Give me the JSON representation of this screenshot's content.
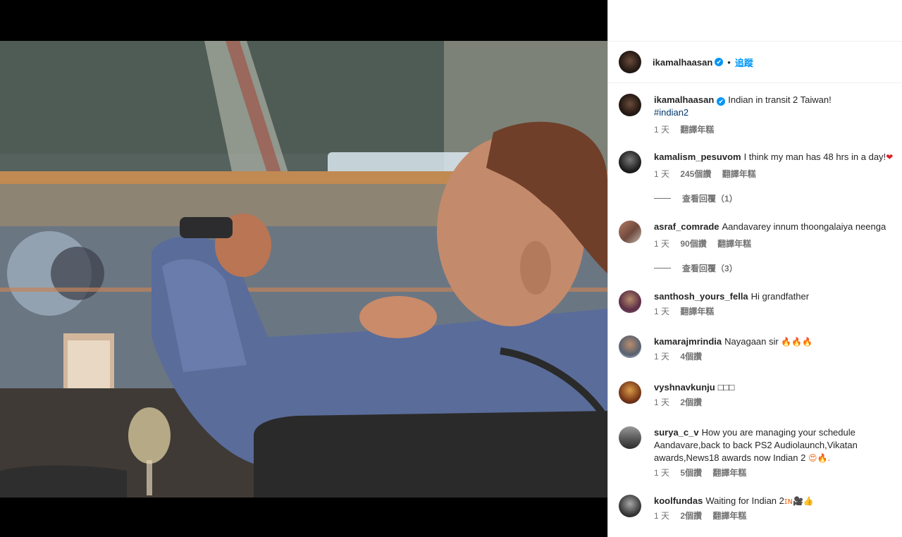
{
  "post": {
    "owner": "ikamalhaasan",
    "follow_label": "追蹤",
    "separator": "•",
    "verified_mark": "✔"
  },
  "caption": {
    "user": "ikamalhaasan",
    "text": "Indian in transit 2 Taiwan!",
    "hashtag": "#indian2",
    "time": "1 天",
    "translate": "翻譯年糕"
  },
  "comments": [
    {
      "user": "kamalism_pesuvom",
      "text": "I think my man has 48 hrs in a day!",
      "emoji": "❤",
      "time": "1 天",
      "likes": "245個讚",
      "translate": "翻譯年糕",
      "replies": "查看回覆（1）",
      "heart_icon": "heart-icon"
    },
    {
      "user": "asraf_comrade",
      "text": "Aandavarey innum thoongalaiya neenga",
      "time": "1 天",
      "likes": "90個讚",
      "translate": "翻譯年糕",
      "replies": "查看回覆（3）"
    },
    {
      "user": "santhosh_yours_fella",
      "text": "Hi grandfather",
      "time": "1 天",
      "translate": "翻譯年糕"
    },
    {
      "user": "kamarajmrindia",
      "text": "Nayagaan sir",
      "emoji": "🔥🔥🔥",
      "time": "1 天",
      "likes": "4個讚"
    },
    {
      "user": "vyshnavkunju",
      "text": "□□□",
      "time": "1 天",
      "likes": "2個讚"
    },
    {
      "user": "surya_c_v",
      "text": "How you are managing your schedule Aandavare,back to back PS2 Audiolaunch,Vikatan awards,News18 awards now Indian 2",
      "emoji": "😍🔥.",
      "time": "1 天",
      "likes": "5個讚",
      "translate": "翻譯年糕"
    },
    {
      "user": "koolfundas",
      "text": "Waiting for Indian 2",
      "emoji": "ɪɴ🎥👍",
      "time": "1 天",
      "likes": "2個讚",
      "translate": "翻譯年糕"
    }
  ],
  "colors": {
    "link_blue": "#0095f6",
    "hashtag": "#00376b",
    "muted": "#737373",
    "text": "#262626",
    "like_red": "#ed4956"
  }
}
